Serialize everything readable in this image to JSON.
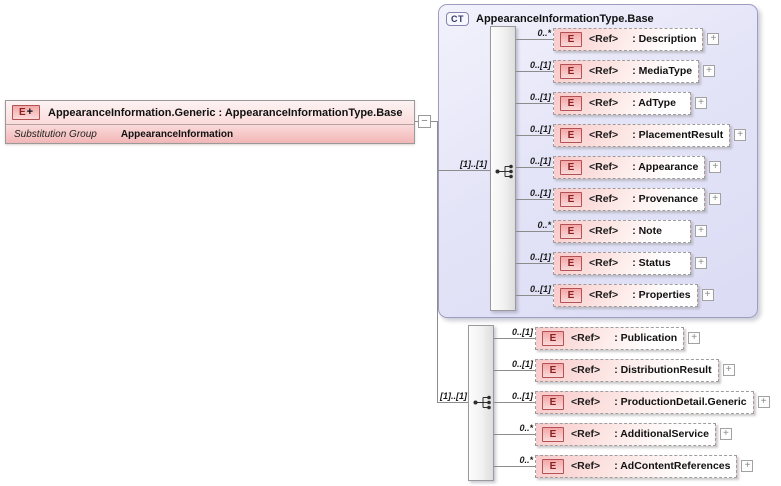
{
  "main_element": {
    "badge": "E",
    "badge_plus": "+",
    "title": "AppearanceInformation.Generic : AppearanceInformationType.Base",
    "substitution_group_label": "Substitution Group",
    "substitution_group_value": "AppearanceInformation",
    "collapse_glyph": "−"
  },
  "complex_type": {
    "badge": "CT",
    "title": "AppearanceInformationType.Base",
    "cardinality": "[1]..[1]",
    "items": [
      {
        "cardinality": "0..*",
        "badge": "E",
        "ref": "<Ref>",
        "name": ": Description",
        "expand": "+"
      },
      {
        "cardinality": "0..[1]",
        "badge": "E",
        "ref": "<Ref>",
        "name": ": MediaType",
        "expand": "+"
      },
      {
        "cardinality": "0..[1]",
        "badge": "E",
        "ref": "<Ref>",
        "name": ": AdType",
        "expand": "+"
      },
      {
        "cardinality": "0..[1]",
        "badge": "E",
        "ref": "<Ref>",
        "name": ": PlacementResult",
        "expand": "+"
      },
      {
        "cardinality": "0..[1]",
        "badge": "E",
        "ref": "<Ref>",
        "name": ": Appearance",
        "expand": "+"
      },
      {
        "cardinality": "0..[1]",
        "badge": "E",
        "ref": "<Ref>",
        "name": ": Provenance",
        "expand": "+"
      },
      {
        "cardinality": "0..*",
        "badge": "E",
        "ref": "<Ref>",
        "name": ": Note",
        "expand": "+"
      },
      {
        "cardinality": "0..[1]",
        "badge": "E",
        "ref": "<Ref>",
        "name": ": Status",
        "expand": "+"
      },
      {
        "cardinality": "0..[1]",
        "badge": "E",
        "ref": "<Ref>",
        "name": ": Properties",
        "expand": "+"
      }
    ]
  },
  "extension_group": {
    "cardinality": "[1]..[1]",
    "items": [
      {
        "cardinality": "0..[1]",
        "badge": "E",
        "ref": "<Ref>",
        "name": ": Publication",
        "expand": "+"
      },
      {
        "cardinality": "0..[1]",
        "badge": "E",
        "ref": "<Ref>",
        "name": ": DistributionResult",
        "expand": "+"
      },
      {
        "cardinality": "0..[1]",
        "badge": "E",
        "ref": "<Ref>",
        "name": ": ProductionDetail.Generic",
        "expand": "+"
      },
      {
        "cardinality": "0..*",
        "badge": "E",
        "ref": "<Ref>",
        "name": ": AdditionalService",
        "expand": "+"
      },
      {
        "cardinality": "0..*",
        "badge": "E",
        "ref": "<Ref>",
        "name": ": AdContentReferences",
        "expand": "+"
      }
    ]
  }
}
